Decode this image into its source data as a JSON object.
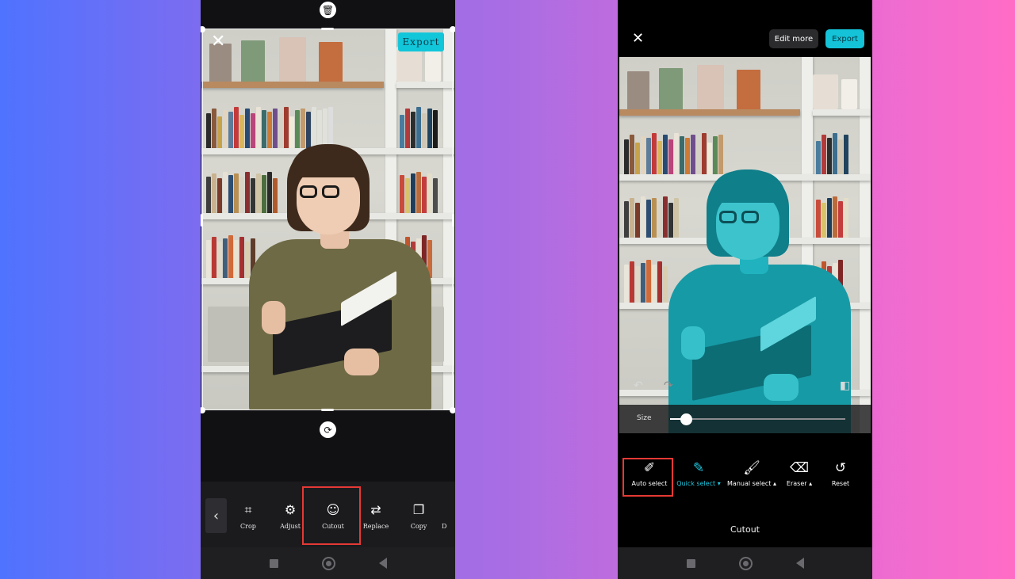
{
  "left_phone": {
    "export_label": "Export",
    "toolbar": {
      "tools": [
        {
          "icon": "crop-icon",
          "label": "Crop"
        },
        {
          "icon": "adjust-icon",
          "label": "Adjust"
        },
        {
          "icon": "cutout-icon",
          "label": "Cutout",
          "highlighted": true
        },
        {
          "icon": "replace-icon",
          "label": "Replace"
        },
        {
          "icon": "copy-icon",
          "label": "Copy"
        }
      ]
    }
  },
  "right_phone": {
    "edit_more_label": "Edit more",
    "export_label": "Export",
    "size_label": "Size",
    "size_value_fraction": 0.09,
    "tools": [
      {
        "icon": "auto-select-ai-icon",
        "label": "Auto select",
        "highlighted": true
      },
      {
        "icon": "quick-select-icon",
        "label": "Quick select ▾",
        "active": true
      },
      {
        "icon": "brush-icon",
        "label": "Manual select ▴"
      },
      {
        "icon": "eraser-icon",
        "label": "Eraser ▴"
      },
      {
        "icon": "reset-icon",
        "label": "Reset"
      }
    ],
    "panel_title": "Cutout"
  },
  "colors": {
    "accent_cyan": "#12c6da",
    "highlight_red": "#e53935",
    "selection_tint": "#0ab0be"
  }
}
